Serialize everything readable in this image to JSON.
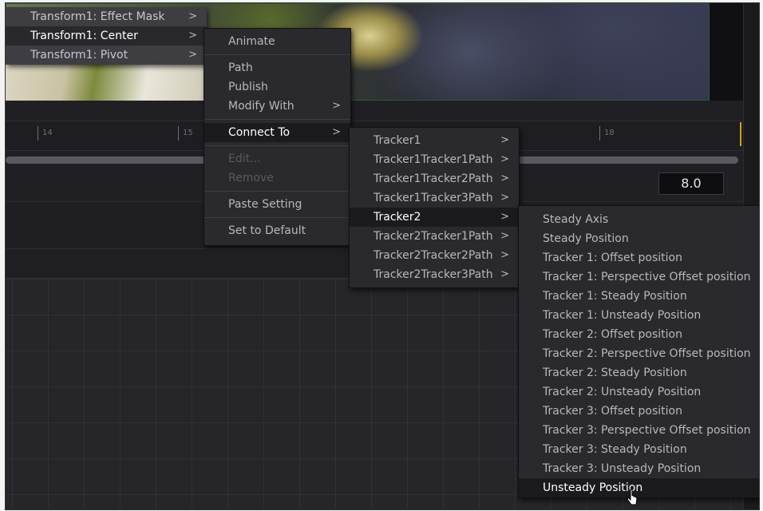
{
  "menu_transform": [
    {
      "label": "Transform1: Effect Mask",
      "arrow": ">",
      "state": "normal"
    },
    {
      "label": "Transform1: Center",
      "arrow": ">",
      "state": "highlighted"
    },
    {
      "label": "Transform1: Pivot",
      "arrow": ">",
      "state": "normal"
    }
  ],
  "menu_context": {
    "animate": "Animate",
    "path": "Path",
    "publish": "Publish",
    "modify_with": "Modify With",
    "connect_to": "Connect To",
    "edit": "Edit...",
    "remove": "Remove",
    "paste_setting": "Paste Setting",
    "set_to_default": "Set to Default",
    "arrow": ">"
  },
  "menu_trackers": [
    {
      "label": "Tracker1",
      "arrow": ">",
      "state": "normal"
    },
    {
      "label": "Tracker1Tracker1Path",
      "arrow": ">",
      "state": "normal"
    },
    {
      "label": "Tracker1Tracker2Path",
      "arrow": ">",
      "state": "normal"
    },
    {
      "label": "Tracker1Tracker3Path",
      "arrow": ">",
      "state": "normal"
    },
    {
      "label": "Tracker2",
      "arrow": ">",
      "state": "highlighted"
    },
    {
      "label": "Tracker2Tracker1Path",
      "arrow": ">",
      "state": "normal"
    },
    {
      "label": "Tracker2Tracker2Path",
      "arrow": ">",
      "state": "normal"
    },
    {
      "label": "Tracker2Tracker3Path",
      "arrow": ">",
      "state": "normal"
    }
  ],
  "menu_tracker2_outputs": [
    {
      "label": "Steady Axis",
      "state": "normal"
    },
    {
      "label": "Steady Position",
      "state": "normal"
    },
    {
      "label": "Tracker 1: Offset position",
      "state": "normal"
    },
    {
      "label": "Tracker 1: Perspective Offset position",
      "state": "normal"
    },
    {
      "label": "Tracker 1: Steady Position",
      "state": "normal"
    },
    {
      "label": "Tracker 1: Unsteady Position",
      "state": "normal"
    },
    {
      "label": "Tracker 2: Offset position",
      "state": "normal"
    },
    {
      "label": "Tracker 2: Perspective Offset position",
      "state": "normal"
    },
    {
      "label": "Tracker 2: Steady Position",
      "state": "normal"
    },
    {
      "label": "Tracker 2: Unsteady Position",
      "state": "normal"
    },
    {
      "label": "Tracker 3: Offset position",
      "state": "normal"
    },
    {
      "label": "Tracker 3: Perspective Offset position",
      "state": "normal"
    },
    {
      "label": "Tracker 3: Steady Position",
      "state": "normal"
    },
    {
      "label": "Tracker 3: Unsteady Position",
      "state": "normal"
    },
    {
      "label": "Unsteady Position",
      "state": "highlighted"
    }
  ],
  "ruler": {
    "ticks": [
      "14",
      "15",
      "18"
    ]
  },
  "value_field": "8.0",
  "colors": {
    "playhead": "#d4a017",
    "menu_bg": "#2a2a2e",
    "highlight_bg": "#1b1b1e"
  },
  "icons": {
    "cursor": "pointer-cursor-icon",
    "submenu": "chevron-right-icon"
  }
}
